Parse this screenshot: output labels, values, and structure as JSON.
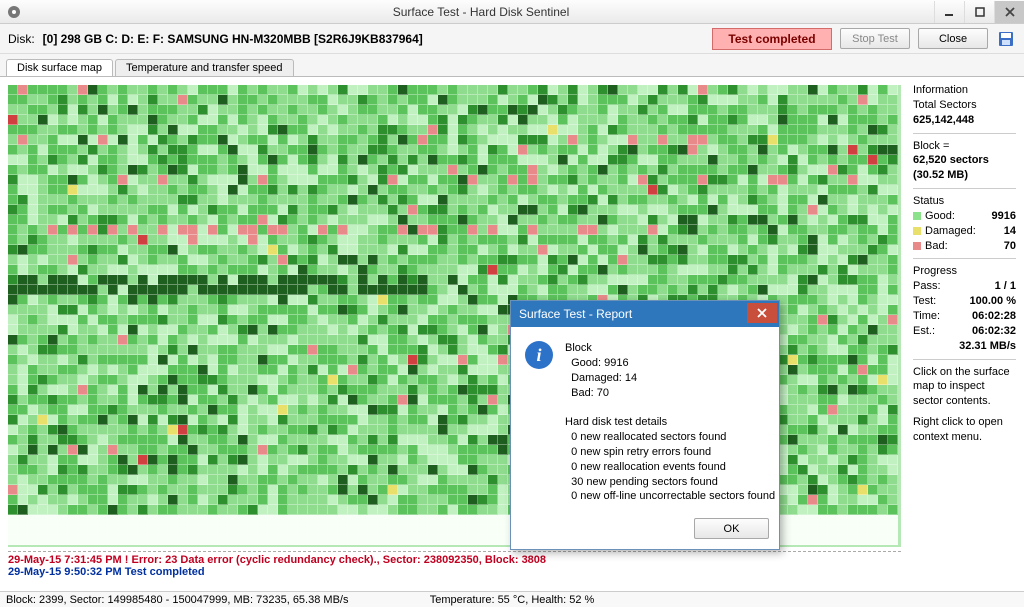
{
  "window": {
    "title": "Surface Test - Hard Disk Sentinel"
  },
  "toolbar": {
    "disk_label": "Disk:",
    "disk_value": "[0]  298 GB C: D: E: F: SAMSUNG HN-M320MBB [S2R6J9KB837964]",
    "status": "Test completed",
    "stop": "Stop Test",
    "close": "Close"
  },
  "tabs": {
    "map": "Disk surface map",
    "temp": "Temperature and transfer speed"
  },
  "side": {
    "info_title": "Information",
    "total_sectors_label": "Total Sectors",
    "total_sectors": "625,142,448",
    "block_label": "Block =",
    "block_sectors": "62,520 sectors",
    "block_mb": "(30.52 MB)",
    "status_title": "Status",
    "good_label": "Good:",
    "good": "9916",
    "dmg_label": "Damaged:",
    "dmg": "14",
    "bad_label": "Bad:",
    "bad": "70",
    "progress_title": "Progress",
    "pass_label": "Pass:",
    "pass": "1 / 1",
    "test_label": "Test:",
    "test": "100.00 %",
    "time_label": "Time:",
    "time": "06:02:28",
    "est_label": "Est.:",
    "est": "06:02:32",
    "rate": "32.31 MB/s",
    "hint1": "Click on the surface map to inspect sector contents.",
    "hint2": "Right click to open context menu."
  },
  "log": {
    "line1": "29-May-15  7:31:45 PM ! Error: 23 Data error (cyclic redundancy check)., Sector: 238092350, Block: 3808",
    "line2": "29-May-15  9:50:32 PM   Test completed"
  },
  "statusbar": {
    "left": "Block: 2399, Sector: 149985480 - 150047999, MB: 73235, 65.38 MB/s",
    "center": "Temperature: 55  °C,  Health: 52 %"
  },
  "dialog": {
    "title": "Surface Test - Report",
    "body": "Block\n  Good: 9916\n  Damaged: 14\n  Bad: 70\n\nHard disk test details\n  0 new reallocated sectors found\n  0 new spin retry errors found\n  0 new reallocation events found\n  30 new pending sectors found\n  0 new off-line uncorrectable sectors found",
    "ok": "OK"
  }
}
